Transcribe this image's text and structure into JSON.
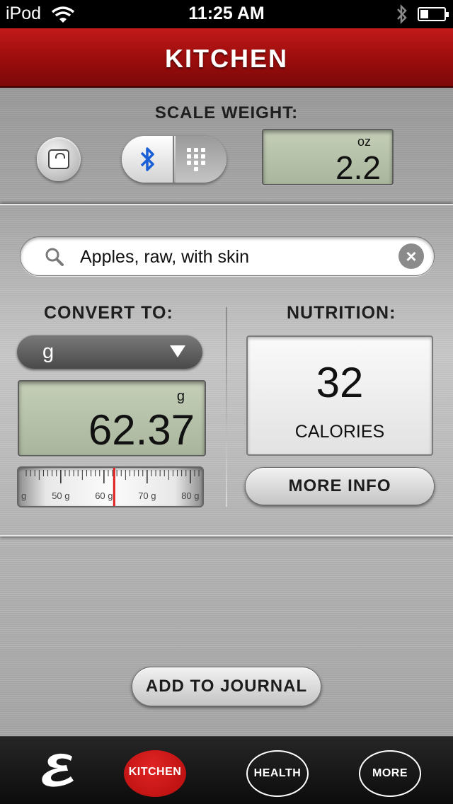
{
  "status_bar": {
    "carrier": "iPod",
    "time": "11:25 AM"
  },
  "header": {
    "title": "KITCHEN"
  },
  "scale": {
    "label": "SCALE WEIGHT:",
    "unit": "oz",
    "value": "2.2"
  },
  "search": {
    "value": "Apples, raw, with skin",
    "clear_icon": "×"
  },
  "convert": {
    "title": "CONVERT TO:",
    "selected_unit": "g",
    "unit": "g",
    "value": "62.37",
    "ruler": {
      "ticks": [
        "g",
        "50 g",
        "60 g",
        "70 g",
        "80 g"
      ],
      "current": 62.37
    }
  },
  "nutrition": {
    "title": "NUTRITION:",
    "calories": "32",
    "calories_label": "CALORIES",
    "more_info": "MORE INFO"
  },
  "actions": {
    "add_to_journal": "ADD TO JOURNAL"
  },
  "tabs": [
    {
      "label": "KITCHEN",
      "active": true
    },
    {
      "label": "HEALTH",
      "active": false
    },
    {
      "label": "MORE",
      "active": false
    }
  ],
  "colors": {
    "brand_red": "#b40c0c",
    "lcd": "#b8c2aa"
  },
  "icons": [
    "wifi-icon",
    "bluetooth-icon",
    "battery-icon",
    "scale-icon",
    "keypad-icon",
    "search-icon",
    "clear-icon",
    "dropdown-arrow-icon",
    "logo-icon"
  ]
}
